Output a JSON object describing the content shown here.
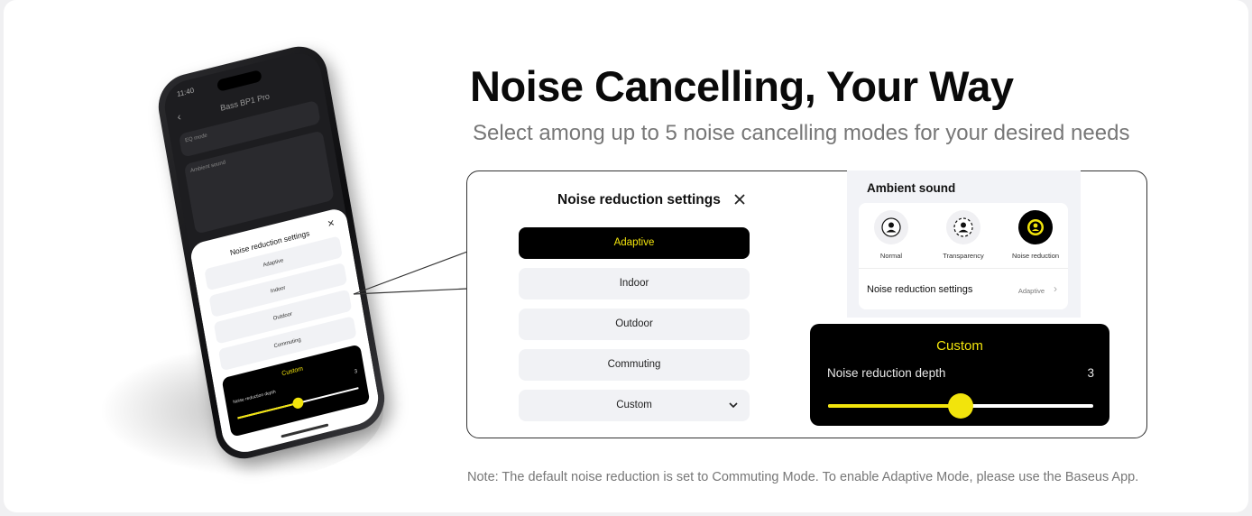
{
  "heading": {
    "title": "Noise Cancelling, Your Way",
    "subtitle": "Select among up to 5 noise cancelling modes for your desired needs"
  },
  "phone": {
    "status_time": "11:40",
    "app_title": "Bass BP1 Pro",
    "eq_label": "EQ mode",
    "ambient_label": "Ambient sound",
    "sheet_title": "Noise reduction settings",
    "options": [
      "Adaptive",
      "Indoor",
      "Outdoor",
      "Commuting"
    ],
    "custom_title": "Custom",
    "depth_label": "Noise reduction depth",
    "depth_value": "3"
  },
  "noise_reduction": {
    "title": "Noise reduction settings",
    "options": [
      {
        "label": "Adaptive",
        "selected": true
      },
      {
        "label": "Indoor",
        "selected": false
      },
      {
        "label": "Outdoor",
        "selected": false
      },
      {
        "label": "Commuting",
        "selected": false
      },
      {
        "label": "Custom",
        "selected": false
      }
    ]
  },
  "ambient": {
    "title": "Ambient sound",
    "modes": [
      {
        "label": "Normal",
        "icon": "normal-mode-icon",
        "active": false
      },
      {
        "label": "Transparency",
        "icon": "transparency-mode-icon",
        "active": false
      },
      {
        "label": "Noise reduction",
        "icon": "noise-reduction-mode-icon",
        "active": true
      }
    ],
    "settings_label": "Noise reduction settings",
    "settings_value": "Adaptive"
  },
  "custom": {
    "title": "Custom",
    "depth_label": "Noise reduction depth",
    "depth_value": "3",
    "slider_level": 0.5
  },
  "note": "Note: The default noise reduction is set to Commuting Mode. To enable Adaptive Mode, please use the Baseus App.",
  "colors": {
    "accent": "#f2e40c",
    "dark": "#000000",
    "option_bg": "#f1f2f5"
  }
}
